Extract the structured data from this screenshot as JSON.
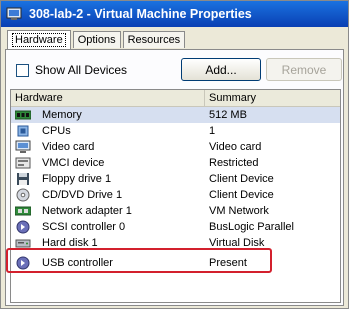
{
  "window": {
    "title": "308-lab-2 - Virtual Machine Properties"
  },
  "tabs": [
    {
      "label": "Hardware",
      "active": true
    },
    {
      "label": "Options",
      "active": false
    },
    {
      "label": "Resources",
      "active": false
    }
  ],
  "show_all": {
    "label": "Show All Devices",
    "checked": false
  },
  "buttons": {
    "add": "Add...",
    "remove": "Remove"
  },
  "table": {
    "headers": {
      "hardware": "Hardware",
      "summary": "Summary"
    },
    "rows": [
      {
        "name": "Memory",
        "summary": "512 MB",
        "icon": "memory-icon",
        "selected": true
      },
      {
        "name": "CPUs",
        "summary": "1",
        "icon": "cpu-icon",
        "selected": false
      },
      {
        "name": "Video card",
        "summary": "Video card",
        "icon": "monitor-icon",
        "selected": false
      },
      {
        "name": "VMCI device",
        "summary": "Restricted",
        "icon": "vmci-icon",
        "selected": false
      },
      {
        "name": "Floppy drive 1",
        "summary": "Client Device",
        "icon": "floppy-icon",
        "selected": false
      },
      {
        "name": "CD/DVD Drive 1",
        "summary": "Client Device",
        "icon": "cd-icon",
        "selected": false
      },
      {
        "name": "Network adapter 1",
        "summary": "VM Network",
        "icon": "network-icon",
        "selected": false
      },
      {
        "name": "SCSI controller 0",
        "summary": "BusLogic Parallel",
        "icon": "scsi-icon",
        "selected": false
      },
      {
        "name": "Hard disk 1",
        "summary": "Virtual Disk",
        "icon": "disk-icon",
        "selected": false
      },
      {
        "name": "USB controller",
        "summary": "Present",
        "icon": "usb-icon",
        "selected": false
      }
    ]
  },
  "colors": {
    "title_bar": "#0a4fd0",
    "highlight": "#d3202d",
    "selection": "#d6dff0"
  }
}
